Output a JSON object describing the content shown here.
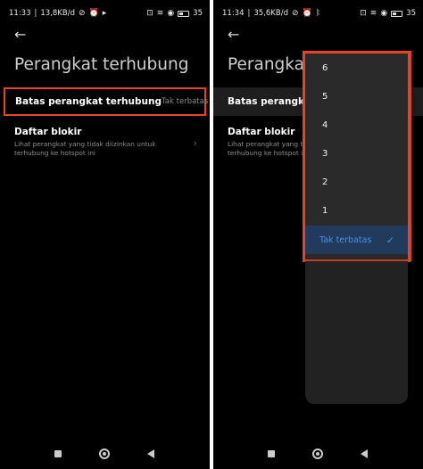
{
  "left": {
    "status": {
      "time": "11:33",
      "speed": "13,8KB/d",
      "battery": "35"
    },
    "title": "Perangkat terhubung",
    "limit_row": {
      "title": "Batas perangkat terhubung",
      "value": "Tak terbatas"
    },
    "blocklist_row": {
      "title": "Daftar blokir",
      "desc": "Lihat perangkat yang tidak diizinkan untuk terhubung ke hotspot ini"
    }
  },
  "right": {
    "status": {
      "time": "11:34",
      "speed": "35,6KB/d",
      "battery": "35"
    },
    "title": "Perangkat terhubung",
    "limit_row": {
      "title": "Batas perangkat terhubung"
    },
    "blocklist_row": {
      "title": "Daftar blokir",
      "desc": "Lihat perangkat yang tidak diizinkan untuk terhubung ke hotspot ini"
    },
    "dropdown": {
      "options": [
        "6",
        "5",
        "4",
        "3",
        "2",
        "1"
      ],
      "selected": "Tak terbatas"
    }
  },
  "accent_color": "#4a8ff0",
  "highlight_color": "#e8432a"
}
